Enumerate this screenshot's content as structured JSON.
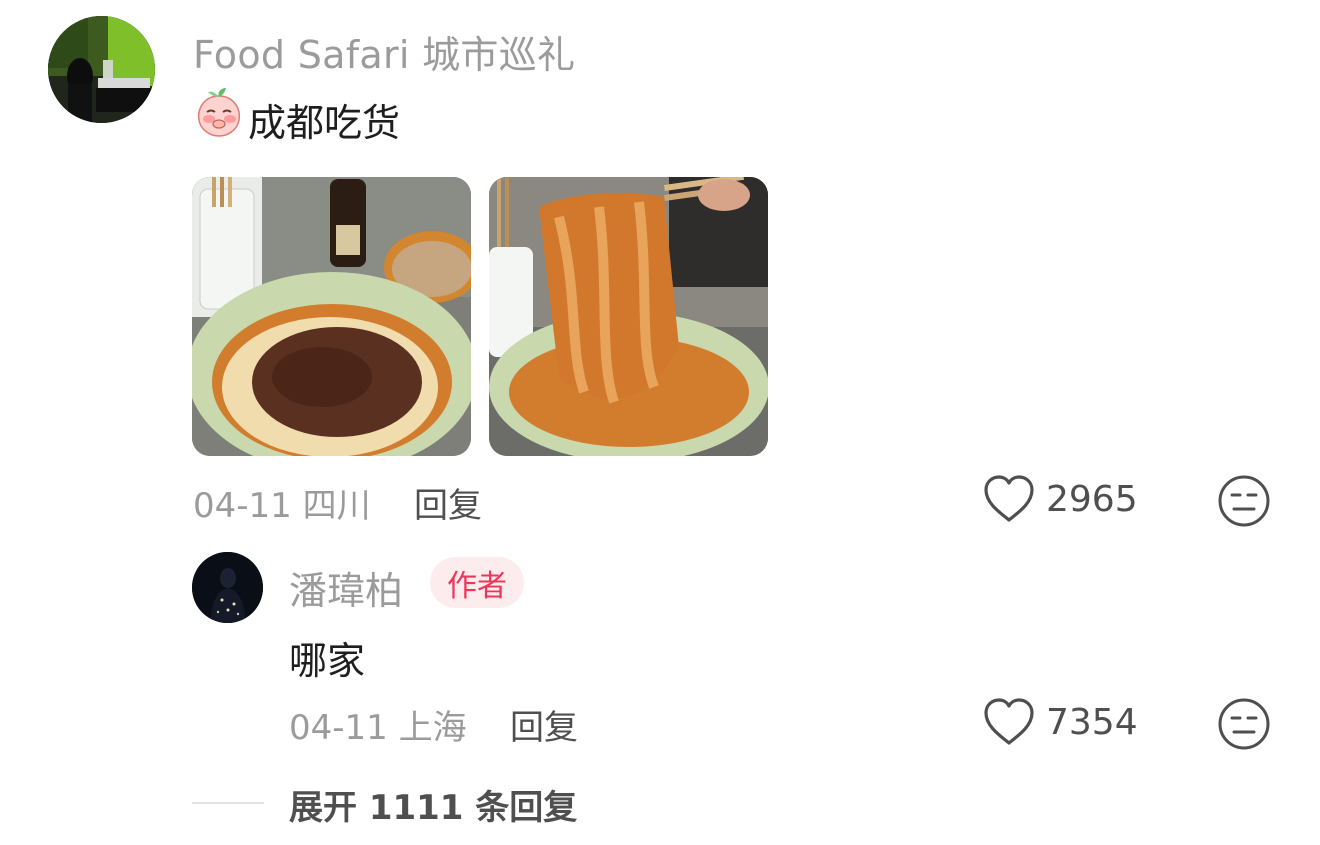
{
  "comment": {
    "username": "Food Safari 城市巡礼",
    "emoji_icon": "blushing-peach-emoji",
    "text": "成都吃货",
    "date": "04-11",
    "location": "四川",
    "reply_label": "回复",
    "like_count": "2965"
  },
  "reply": {
    "username": "潘瑋柏",
    "author_badge": "作者",
    "text": "哪家",
    "date": "04-11",
    "location": "上海",
    "reply_label": "回复",
    "like_count": "7354"
  },
  "expand": {
    "label": "展开 1111 条回复"
  },
  "icons": {
    "like": "heart-outline-icon",
    "dislike": "unamused-face-icon"
  },
  "colors": {
    "badge_text": "#f0355b",
    "badge_bg": "#fdecee",
    "muted_text": "#9b9b9b",
    "secondary_text": "#4f4f4f"
  }
}
